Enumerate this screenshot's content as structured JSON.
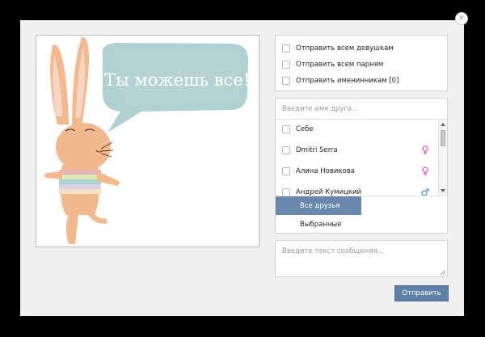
{
  "dialog": {
    "close_glyph": "×"
  },
  "card": {
    "speech_text": "Ты можешь все!"
  },
  "recipients": {
    "options": [
      {
        "label": "Отправить всем девушкам",
        "checked": false
      },
      {
        "label": "Отправить всем парням",
        "checked": false
      },
      {
        "label": "Отправить именинникам [0]",
        "checked": false
      }
    ]
  },
  "friends": {
    "search_placeholder": "Введите имя друга...",
    "list": [
      {
        "name": "Себе",
        "gender_icon": "",
        "checked": false
      },
      {
        "name": "Dmitri Serra",
        "gender_icon": "female-icon",
        "checked": false
      },
      {
        "name": "Алина Новикова",
        "gender_icon": "female-icon",
        "checked": false
      },
      {
        "name": "Андрей Кумицкий",
        "gender_icon": "male-icon",
        "checked": false
      }
    ],
    "tabs": [
      {
        "label": "Все друзья",
        "active": true
      },
      {
        "label": "Выбранные",
        "active": false
      }
    ]
  },
  "message": {
    "placeholder": "Введите текст сообщения..."
  },
  "send_label": "Отправить",
  "colors": {
    "accent": "#6a87ad",
    "button": "#5f7ea8",
    "bubble": "#9fc4c4",
    "female_icon": "#e070c0",
    "male_icon": "#6a9ad0"
  }
}
